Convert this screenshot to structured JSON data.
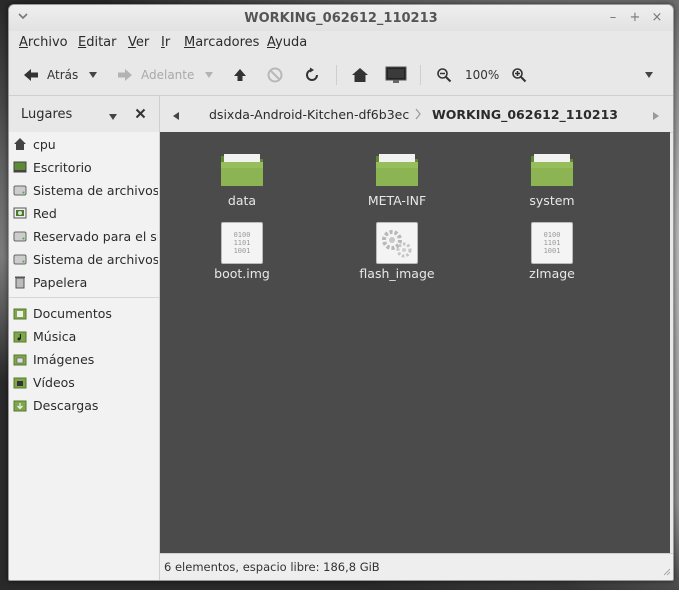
{
  "window": {
    "title": "WORKING_062612_110213"
  },
  "window_controls": {
    "minimize": "–",
    "maximize": "+",
    "close": "×"
  },
  "menubar": [
    {
      "label": "Archivo",
      "mnemonic": "A",
      "rest": "rchivo"
    },
    {
      "label": "Editar",
      "mnemonic": "E",
      "rest": "ditar"
    },
    {
      "label": "Ver",
      "mnemonic": "V",
      "rest": "er"
    },
    {
      "label": "Ir",
      "mnemonic": "I",
      "rest": "r"
    },
    {
      "label": "Marcadores",
      "mnemonic": "M",
      "rest": "arcadores"
    },
    {
      "label": "Ayuda",
      "mnemonic": "A",
      "rest": "yuda"
    }
  ],
  "toolbar": {
    "back_label": "Atrás",
    "forward_label": "Adelante",
    "zoom_level": "100%"
  },
  "sidebar": {
    "title": "Lugares",
    "places": [
      {
        "label": "cpu",
        "icon": "home-icon"
      },
      {
        "label": "Escritorio",
        "icon": "desktop-icon"
      },
      {
        "label": "Sistema de archivos",
        "icon": "drive-icon"
      },
      {
        "label": "Red",
        "icon": "network-icon"
      },
      {
        "label": "Reservado para el sistema",
        "icon": "drive-icon"
      },
      {
        "label": "Sistema de archivos",
        "icon": "drive-icon"
      },
      {
        "label": "Papelera",
        "icon": "trash-icon"
      }
    ],
    "bookmarks": [
      {
        "label": "Documentos",
        "icon": "folder-icon"
      },
      {
        "label": "Música",
        "icon": "folder-icon"
      },
      {
        "label": "Imágenes",
        "icon": "folder-icon"
      },
      {
        "label": "Vídeos",
        "icon": "folder-icon"
      },
      {
        "label": "Descargas",
        "icon": "folder-icon"
      }
    ]
  },
  "pathbar": {
    "crumbs": [
      "dsixda-Android-Kitchen-df6b3ec",
      "WORKING_062612_110213"
    ]
  },
  "files": [
    {
      "name": "data",
      "type": "folder"
    },
    {
      "name": "META-INF",
      "type": "folder"
    },
    {
      "name": "system",
      "type": "folder"
    },
    {
      "name": "boot.img",
      "type": "binary"
    },
    {
      "name": "flash_image",
      "type": "executable"
    },
    {
      "name": "zImage",
      "type": "binary"
    }
  ],
  "binary_glyph": [
    "0100",
    "1101",
    "1001"
  ],
  "status": {
    "text": "6 elementos, espacio libre: 186,8 GiB"
  },
  "colors": {
    "content_bg": "#4b4b4b",
    "folder_green": "#7fa64a",
    "accent": "#7fa64a"
  }
}
